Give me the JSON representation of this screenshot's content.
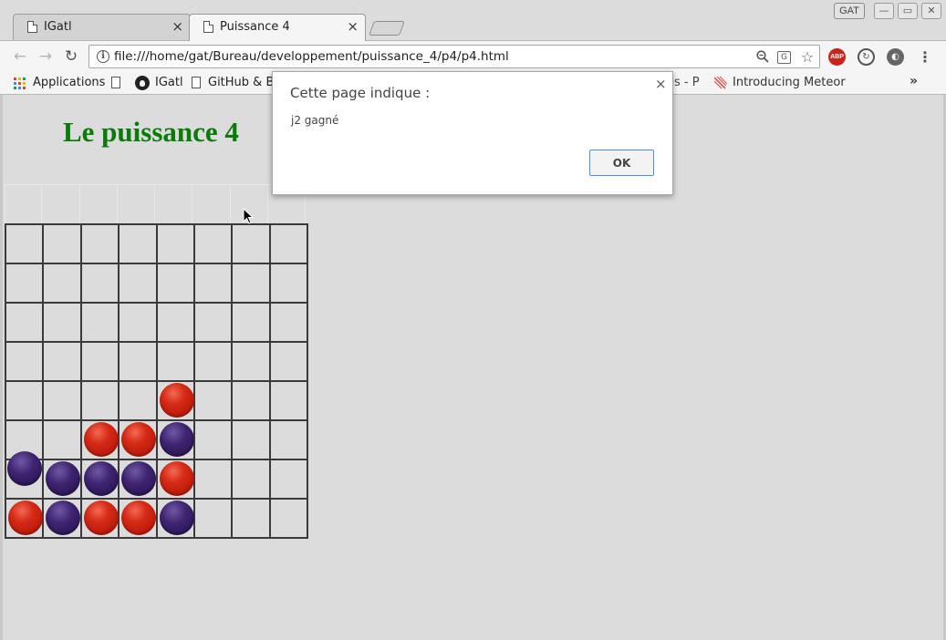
{
  "window": {
    "profile_label": "GAT",
    "minimize_glyph": "—",
    "maximize_glyph": "▭",
    "close_glyph": "✕"
  },
  "tabs": [
    {
      "title": "IGatl",
      "active": false,
      "close_glyph": "×"
    },
    {
      "title": "Puissance 4",
      "active": true,
      "close_glyph": "×"
    }
  ],
  "toolbar": {
    "back_glyph": "←",
    "forward_glyph": "→",
    "reload_glyph": "↻",
    "url": "file:///home/gat/Bureau/developpement/puissance_4/p4/p4.html",
    "info_glyph": "i",
    "zoom_glyph": "🔍",
    "translate_glyph": "G",
    "star_glyph": "☆",
    "abp_label": "ABP",
    "sync_glyph": "↻",
    "ext_glyph": "◐",
    "menu_glyph": "⋮"
  },
  "bookmarks": {
    "apps": "Applications",
    "igatl": "IGatl",
    "github": "GitHub & Bit",
    "hidden_fragment": "es - P",
    "meteor": "Introducing Meteor",
    "more_glyph": "»",
    "apps_grid_colors": [
      "#db4437",
      "#f4b400",
      "#0f9d58",
      "#4285f4",
      "#db4437",
      "#f4b400",
      "#0f9d58",
      "#4285f4",
      "#db4437"
    ]
  },
  "page": {
    "title": "Le puissance 4",
    "title_color": "#0a7a0a",
    "board": {
      "columns": 8,
      "rows": 8,
      "red_color": "#d52a16",
      "purple_color": "#3e2470",
      "grid": [
        [
          "",
          "",
          "",
          "",
          "",
          "",
          "",
          ""
        ],
        [
          "",
          "",
          "",
          "",
          "",
          "",
          "",
          ""
        ],
        [
          "",
          "",
          "",
          "",
          "",
          "",
          "",
          ""
        ],
        [
          "",
          "",
          "",
          "",
          "",
          "",
          "",
          ""
        ],
        [
          "",
          "",
          "",
          "",
          "red",
          "",
          "",
          ""
        ],
        [
          "",
          "",
          "red",
          "red",
          "purple",
          "",
          "",
          ""
        ],
        [
          "purple",
          "purple",
          "purple",
          "purple",
          "red",
          "",
          "",
          ""
        ],
        [
          "red",
          "purple",
          "red",
          "red",
          "purple",
          "",
          "",
          ""
        ]
      ]
    }
  },
  "dialog": {
    "title": "Cette page indique :",
    "message": "j2 gagné",
    "ok_label": "OK",
    "close_glyph": "×"
  }
}
